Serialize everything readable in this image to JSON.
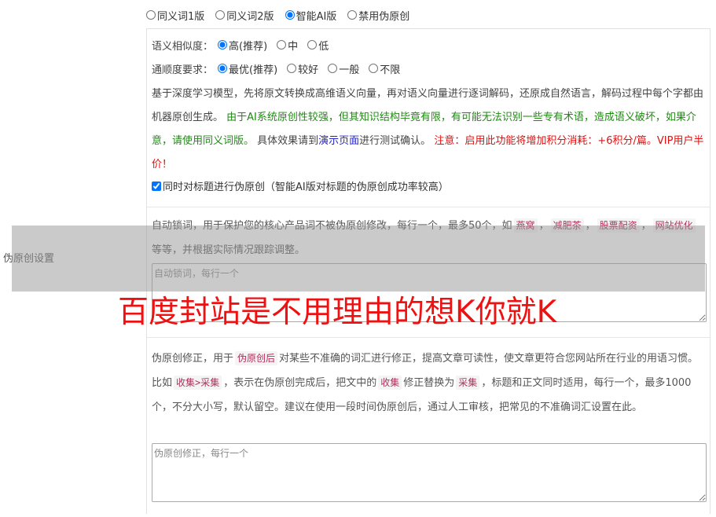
{
  "side_label": "伪原创设置",
  "modes": [
    {
      "label": "同义词1版",
      "checked": false
    },
    {
      "label": "同义词2版",
      "checked": false
    },
    {
      "label": "智能AI版",
      "checked": true
    },
    {
      "label": "禁用伪原创",
      "checked": false
    }
  ],
  "similarity": {
    "label": "语义相似度：",
    "options": [
      {
        "label": "高(推荐)",
        "checked": true
      },
      {
        "label": "中",
        "checked": false
      },
      {
        "label": "低",
        "checked": false
      }
    ]
  },
  "fluency": {
    "label": "通顺度要求：",
    "options": [
      {
        "label": "最优(推荐)",
        "checked": true
      },
      {
        "label": "较好",
        "checked": false
      },
      {
        "label": "一般",
        "checked": false
      },
      {
        "label": "不限",
        "checked": false
      }
    ]
  },
  "description": {
    "part1": "基于深度学习模型，先将原文转换成高维语义向量，再对语义向量进行逐词解码，还原成自然语言，解码过程中每个字都由机器原创生成。 ",
    "green_text": "由于AI系统原创性较强，但其知识结构毕竟有限，有可能无法识别一些专有术语，造成语义破坏，如果介意，请使用同义词版。",
    "part2": " 具体效果请到",
    "demo_link": "演示页面",
    "part3": "进行测试确认。 ",
    "red_text": "注意：启用此功能将增加积分消耗：+6积分/篇。VIP用户半价！"
  },
  "title_checkbox": {
    "label": "同时对标题进行伪原创（智能AI版对标题的伪原创成功率较高）",
    "checked": true
  },
  "lock_words": {
    "help_part1": "自动锁词，用于保护您的核心产品词不被伪原创修改，每行一个，最多50个，如",
    "examples": [
      "燕窝",
      "减肥茶",
      "股票配资",
      "网站优化"
    ],
    "help_part2": "等等，并根据实际情况跟踪调整。",
    "placeholder": "自动锁词，每行一个"
  },
  "corrections": {
    "help_part1": "伪原创修正，用于",
    "tag1": "伪原创后",
    "help_part2": "对某些不准确的词汇进行修正，提高文章可读性，使文章更符合您网站所在行业的用语习惯。比如",
    "tag2": "收集>采集",
    "help_part3": "，表示在伪原创完成后，把文中的",
    "tag3": "收集",
    "help_part4": "修正替换为",
    "tag4": "采集",
    "help_part5": "，标题和正文同时适用，每行一个，最多1000个，不分大小写，默认留空。建议在使用一段时间伪原创后，通过人工审核，把常见的不准确词汇设置在此。",
    "placeholder": "伪原创修正，每行一个"
  },
  "watermark": "百度封站是不用理由的想K你就K"
}
